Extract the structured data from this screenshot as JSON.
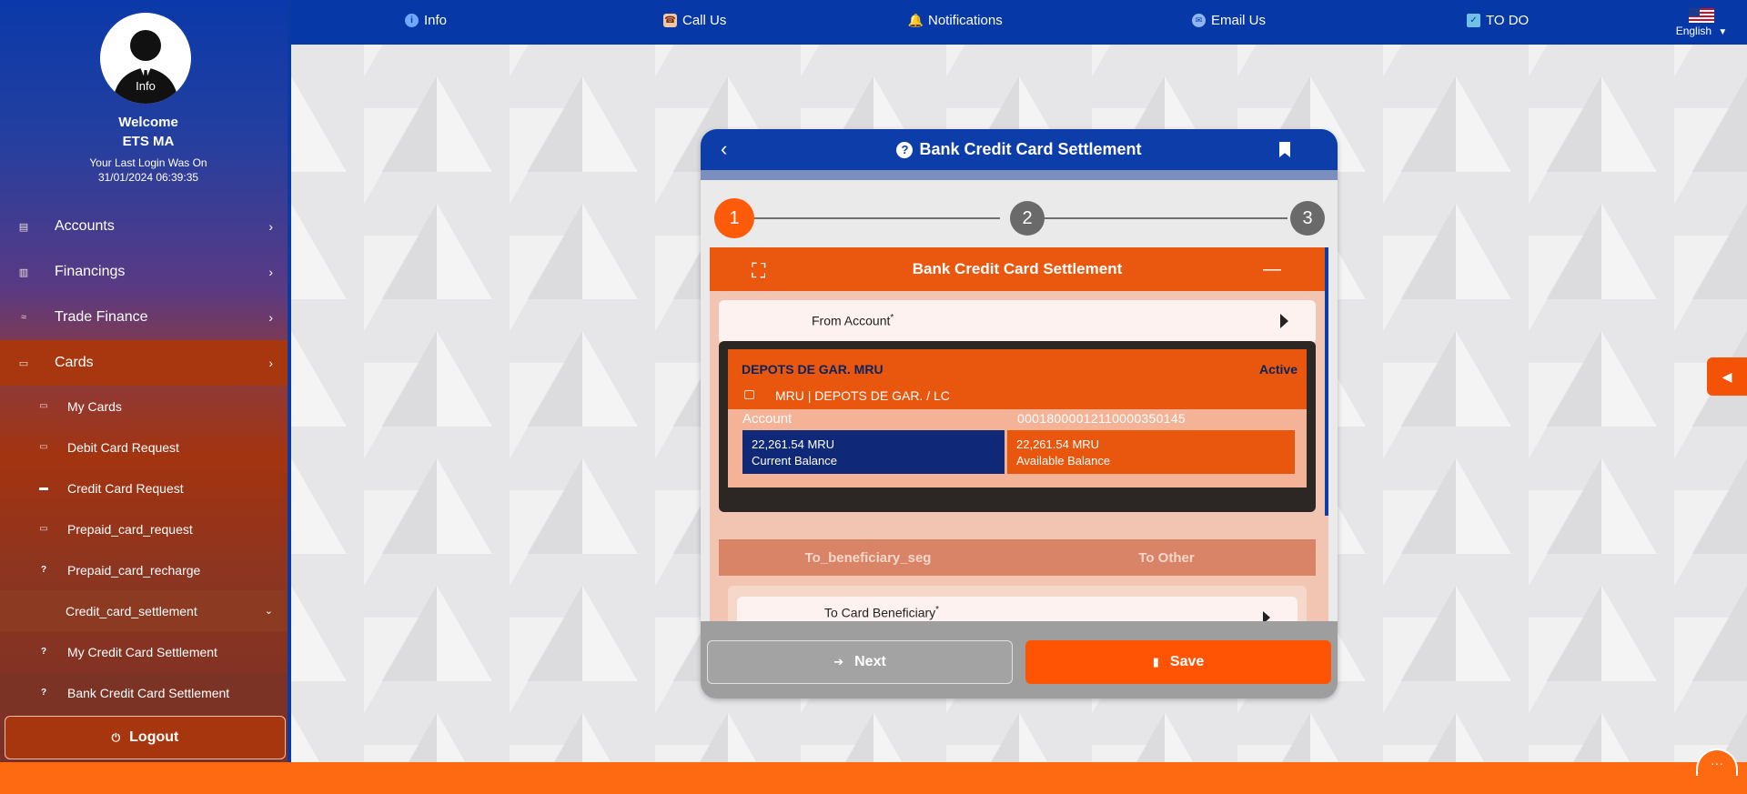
{
  "sidebar": {
    "avatar_label": "Info",
    "welcome": "Welcome",
    "user_name": "ETS MA",
    "last_login_label": "Your Last Login Was On",
    "last_login_time": "31/01/2024 06:39:35",
    "menu": [
      {
        "label": "Accounts",
        "icon": "wallet-icon"
      },
      {
        "label": "Financings",
        "icon": "chart-icon"
      },
      {
        "label": "Trade Finance",
        "icon": "handshake-icon"
      },
      {
        "label": "Cards",
        "icon": "card-icon"
      }
    ],
    "submenu": [
      {
        "label": "My Cards",
        "icon": "card-icon"
      },
      {
        "label": "Debit Card Request",
        "icon": "card-icon"
      },
      {
        "label": "Credit Card Request",
        "icon": "card-icon"
      },
      {
        "label": "Prepaid_card_request",
        "icon": "card-icon"
      },
      {
        "label": "Prepaid_card_recharge",
        "icon": "help-icon"
      },
      {
        "label": "Credit_card_settlement",
        "icon": ""
      },
      {
        "label": "My Credit Card Settlement",
        "icon": "help-icon"
      },
      {
        "label": "Bank Credit Card Settlement",
        "icon": "help-icon"
      }
    ],
    "logout": "Logout"
  },
  "topbar": {
    "items": [
      {
        "label": "Info",
        "icon": "info-icon"
      },
      {
        "label": "Call Us",
        "icon": "phone-icon"
      },
      {
        "label": "Notifications",
        "icon": "bell-icon"
      },
      {
        "label": "Email Us",
        "icon": "email-icon"
      },
      {
        "label": "TO DO",
        "icon": "todo-icon"
      }
    ],
    "language": "English"
  },
  "panel": {
    "title": "Bank Credit Card Settlement",
    "steps": [
      "1",
      "2",
      "3"
    ],
    "active_step": 1,
    "section_title": "Bank Credit Card Settlement",
    "from_account_label": "From Account",
    "required_mark": "*",
    "account": {
      "name": "DEPOTS DE GAR. MRU",
      "status": "Active",
      "description": "MRU | DEPOTS DE GAR. / LC",
      "number_label": "Account",
      "number": "00018000012110000350145",
      "current_balance": "22,261.54 MRU",
      "current_balance_label": "Current Balance",
      "available_balance": "22,261.54 MRU",
      "available_balance_label": "Available Balance"
    },
    "tabs": [
      "To_beneficiary_seg",
      "To Other"
    ],
    "beneficiary_label": "To Card Beneficiary",
    "next_label": "Next",
    "save_label": "Save"
  },
  "colors": {
    "primary_blue": "#0638a8",
    "accent_orange": "#fd5a0a"
  }
}
